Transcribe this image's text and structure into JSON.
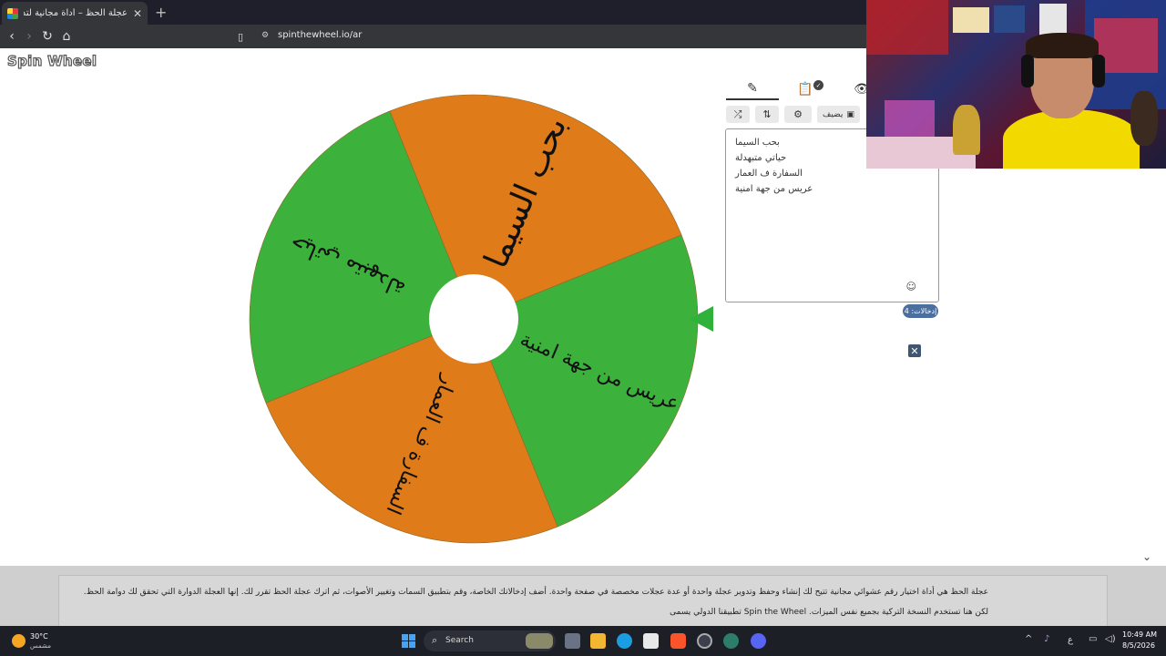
{
  "browser": {
    "tab_title": "عجلة الحظ – أداة مجانية لتدوير الع",
    "tab_close": "✕",
    "new_tab": "+",
    "url": "spinthewheel.io/ar"
  },
  "page": {
    "logo": "Spin Wheel",
    "wheel": {
      "segments": [
        {
          "label": "بحب السيما",
          "color": "#e07b1a",
          "start": -22,
          "end": 68
        },
        {
          "label": "عريس من جهة امنية",
          "color": "#3cb23c",
          "start": 68,
          "end": 158
        },
        {
          "label": "السفارة ف العمار",
          "color": "#e07b1a",
          "start": 158,
          "end": 248
        },
        {
          "label": "حياتي متبهدلة",
          "color": "#3cb23c",
          "start": 248,
          "end": 338
        }
      ],
      "pointer_color": "#2fb13a"
    },
    "panel": {
      "tabs": [
        "✎",
        "📋",
        "👁"
      ],
      "add_label": "يضيف",
      "entries": [
        "بحب السيما",
        "حياتي متبهدلة",
        "السفارة ف العمار",
        "عريس من جهة امنية"
      ],
      "emoji_icon": "☺",
      "count_label": "إدخالات: 4",
      "close_label": "✕"
    },
    "info": {
      "line1": "عجلة الحظ هي أداة اختيار رقم عشوائي مجانية تتيح لك إنشاء وحفظ وتدوير عجلة واحدة أو عدة عجلات مخصصة في صفحة واحدة. أضف إدخالاتك الخاصة، وقم بتطبيق السمات وتغيير الأصوات، ثم اترك عجلة الحظ تقرر لك. إنها العجلة الدوارة التي تحقق لك دوامة الحظ.",
      "line2": "لكن هنا تستخدم النسخة التركية بجميع نفس الميزات. Spin the Wheel تطبيقنا الدولي يسمى"
    }
  },
  "taskbar": {
    "temp": "30°C",
    "weather": "مشمس",
    "search": "Search",
    "time": "10:49 AM",
    "date": "8/5/2026",
    "lang": "ع"
  }
}
